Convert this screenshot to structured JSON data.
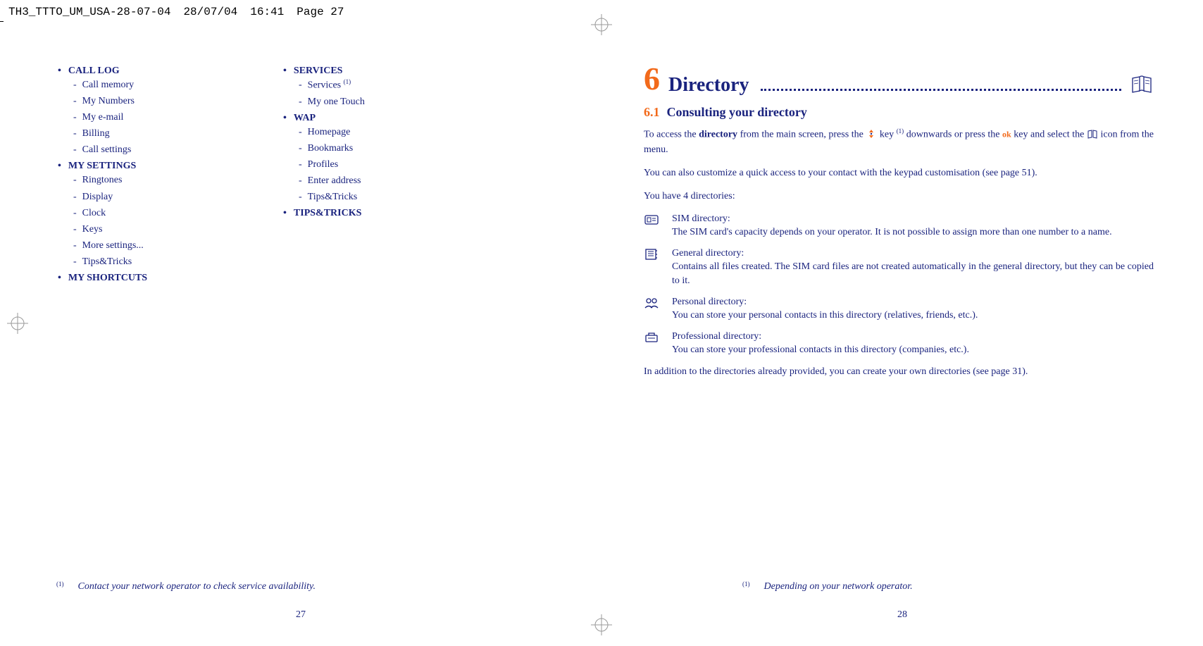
{
  "header": {
    "filename": "TH3_TTTO_UM_USA-28-07-04",
    "date": "28/07/04",
    "time": "16:41",
    "page": "Page 27"
  },
  "left": {
    "menu": [
      {
        "heading": "CALL LOG",
        "items": [
          "Call memory",
          "My Numbers",
          "My e-mail",
          "Billing",
          "Call settings"
        ]
      },
      {
        "heading": "MY SETTINGS",
        "items": [
          "Ringtones",
          "Display",
          "Clock",
          "Keys",
          "More settings...",
          "Tips&Tricks"
        ]
      },
      {
        "heading": "MY SHORTCUTS",
        "items": []
      }
    ],
    "menu_col2": [
      {
        "heading": "SERVICES",
        "items": [
          "Services (1)",
          "My one Touch"
        ]
      },
      {
        "heading": "WAP",
        "items": [
          "Homepage",
          "Bookmarks",
          "Profiles",
          "Enter address",
          "Tips&Tricks"
        ]
      },
      {
        "heading": "TIPS&TRICKS",
        "items": []
      }
    ],
    "footnote_ref": "(1)",
    "footnote": "Contact your network operator to check service availability.",
    "page_num": "27"
  },
  "right": {
    "chapter_num": "6",
    "chapter_title": "Directory",
    "section_num": "6.1",
    "section_title": "Consulting your directory",
    "para1_a": "To access the ",
    "para1_bold": "directory",
    "para1_b": " from the main screen, press the ",
    "para1_c": " key ",
    "para1_sup": "(1)",
    "para1_d": " downwards or press the ",
    "para1_ok": "ok",
    "para1_e": " key and select the ",
    "para1_f": " icon from the menu.",
    "para2": "You can also customize a quick access to your contact with the keypad customisation (see page 51).",
    "para3": "You have 4 directories:",
    "dirs": [
      {
        "title": "SIM directory:",
        "desc": "The SIM card's capacity depends on your operator. It is not possible to assign more than one number to a name."
      },
      {
        "title": "General directory:",
        "desc": "Contains all files created. The SIM card files are not created automatically in the general directory, but they can be copied to it."
      },
      {
        "title": "Personal directory:",
        "desc": "You can store your personal contacts in this directory (relatives, friends, etc.)."
      },
      {
        "title": "Professional directory:",
        "desc": "You can store your professional contacts in this directory (companies, etc.)."
      }
    ],
    "para4": "In addition to the directories already provided, you can create your own directories (see page 31).",
    "footnote_ref": "(1)",
    "footnote": "Depending on your network operator.",
    "page_num": "28"
  }
}
